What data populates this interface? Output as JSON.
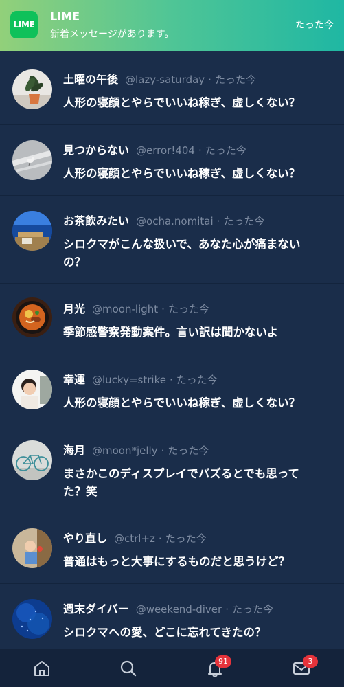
{
  "notification": {
    "icon_text": "LIME",
    "app_name": "LIME",
    "message": "新着メッセージがあります。",
    "time": "たった今",
    "gradient_colors": [
      "#92d07a",
      "#1fb7a3"
    ]
  },
  "posts": [
    {
      "name": "土曜の午後",
      "handle": "@lazy-saturday",
      "separator": "·",
      "time": "たった今",
      "text": "人形の寝顔とやらでいいね稼ぎ、虚しくない？",
      "avatar": "houseplant-avatar"
    },
    {
      "name": "見つからない",
      "handle": "@error!404",
      "separator": "·",
      "time": "たった今",
      "text": "人形の寝顔とやらでいいね稼ぎ、虚しくない？",
      "avatar": "bird-on-road-avatar"
    },
    {
      "name": "お茶飲みたい",
      "handle": "@ocha.nomitai",
      "separator": "·",
      "time": "たった今",
      "text": "シロクマがこんな扱いで、あなた心が痛まないの？",
      "avatar": "ocean-bench-avatar"
    },
    {
      "name": "月光",
      "handle": "@moon-light",
      "separator": "·",
      "time": "たった今",
      "text": "季節感警察発動案件。言い訳は聞かないよ",
      "avatar": "ramen-bowl-avatar"
    },
    {
      "name": "幸運",
      "handle": "@lucky=strike",
      "separator": "·",
      "time": "たった今",
      "text": "人形の寝顔とやらでいいね稼ぎ、虚しくない？",
      "avatar": "child-avatar"
    },
    {
      "name": "海月",
      "handle": "@moon*jelly",
      "separator": "·",
      "time": "たった今",
      "text": "まさかこのディスプレイでバズるとでも思ってた？笑",
      "avatar": "bicycle-avatar"
    },
    {
      "name": "やり直し",
      "handle": "@ctrl+z",
      "separator": "·",
      "time": "たった今",
      "text": "普通はもっと大事にするものだと思うけど？",
      "avatar": "toddler-avatar"
    },
    {
      "name": "週末ダイバー",
      "handle": "@weekend-diver",
      "separator": "·",
      "time": "たった今",
      "text": "シロクマへの愛、どこに忘れてきたの？",
      "avatar": "fish-school-avatar"
    }
  ],
  "nav": {
    "items": [
      "home-icon",
      "search-icon",
      "bell-icon",
      "mail-icon"
    ],
    "notifications_badge": "91",
    "messages_badge": "3"
  },
  "colors": {
    "background": "#1a2d4a",
    "handle": "#7c8aa0",
    "badge": "#e5333b"
  }
}
